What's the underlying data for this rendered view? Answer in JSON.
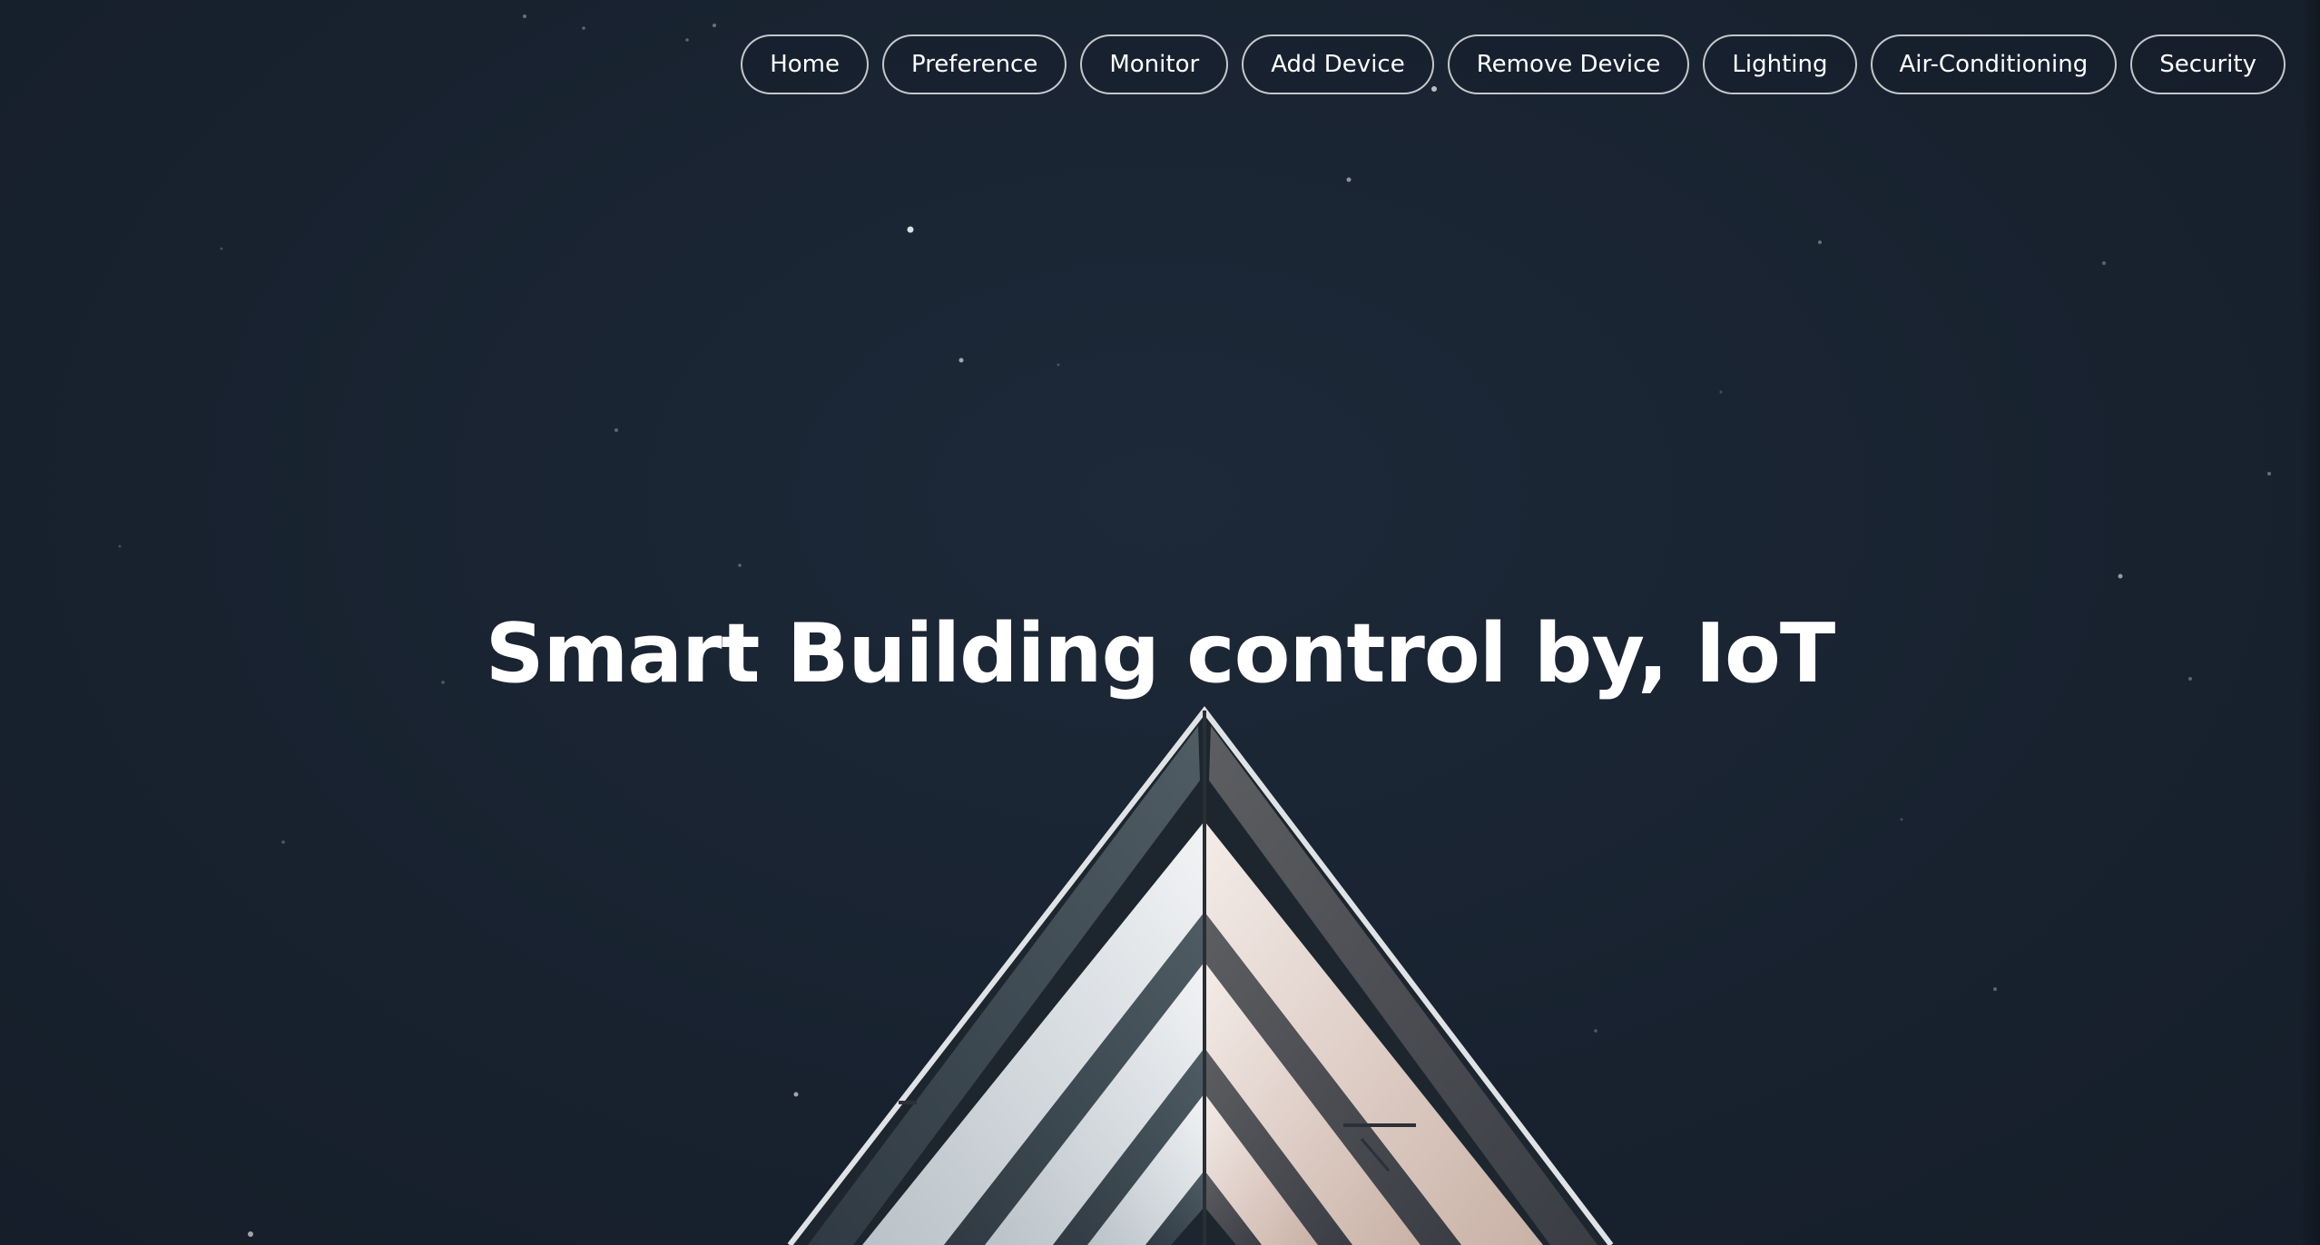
{
  "nav": {
    "items": [
      {
        "label": "Home"
      },
      {
        "label": "Preference"
      },
      {
        "label": "Monitor"
      },
      {
        "label": "Add Device"
      },
      {
        "label": "Remove Device"
      },
      {
        "label": "Lighting"
      },
      {
        "label": "Air-Conditioning"
      },
      {
        "label": "Security"
      }
    ]
  },
  "hero": {
    "title": "Smart Building control by, IoT"
  },
  "colors": {
    "background": "#1a2535",
    "text": "#ffffff",
    "nav_border": "#ffffff"
  }
}
